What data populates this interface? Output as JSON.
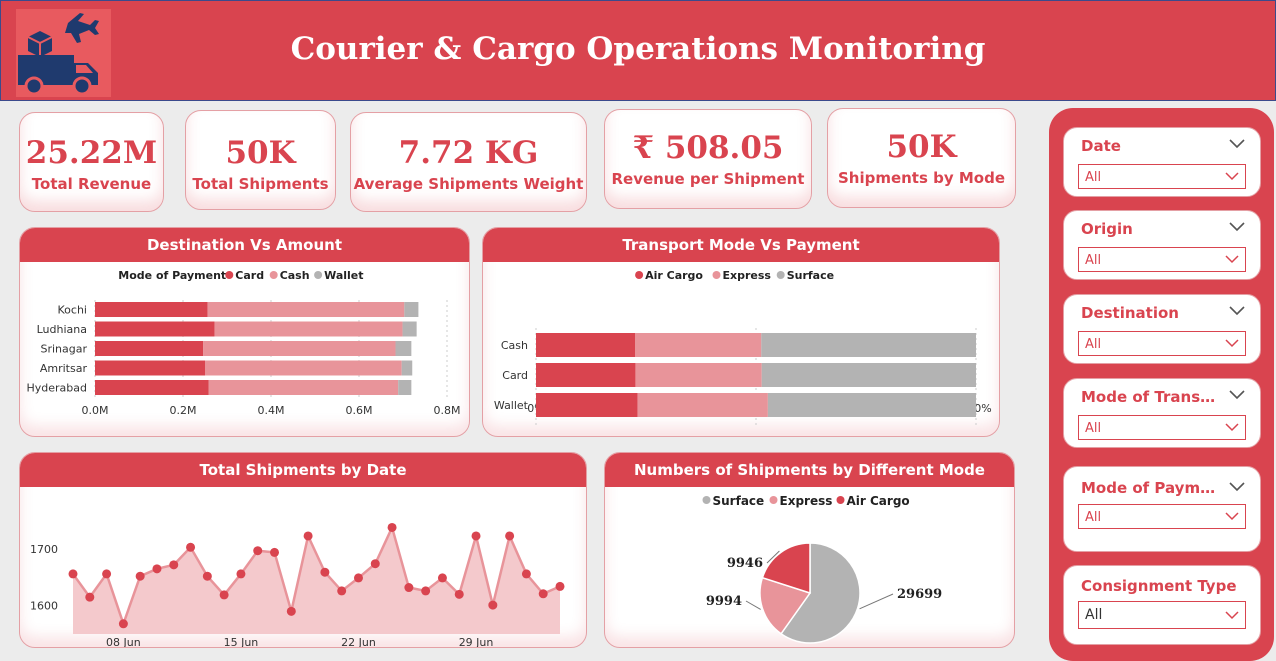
{
  "header": {
    "title": "Courier & Cargo Operations Monitoring",
    "logo_icon": "delivery-truck-plane-icon"
  },
  "kpis": [
    {
      "value": "25.22M",
      "label": "Total Revenue"
    },
    {
      "value": "50K",
      "label": "Total Shipments"
    },
    {
      "value": "7.72 KG",
      "label": "Average Shipments Weight"
    },
    {
      "value": "₹ 508.05",
      "label": "Revenue per Shipment"
    },
    {
      "value": "50K",
      "label": "Shipments by Mode"
    }
  ],
  "colors": {
    "primary": "#d9444f",
    "light": "#e8949a",
    "grey": "#b3b3b3",
    "area": "#f4c9cc"
  },
  "slicers": [
    {
      "name": "Date",
      "value": "All"
    },
    {
      "name": "Origin",
      "value": "All"
    },
    {
      "name": "Destination",
      "value": "All"
    },
    {
      "name": "Mode of Transpo…",
      "value": "All"
    },
    {
      "name": "Mode of Payment",
      "value": "All"
    },
    {
      "name": "Consignment Type",
      "value": "All"
    }
  ],
  "chart_data": [
    {
      "title": "Destination Vs Amount",
      "type": "bar",
      "stacked": true,
      "orientation": "horizontal",
      "legend_title": "Mode of Payment",
      "categories": [
        "Kochi",
        "Ludhiana",
        "Srinagar",
        "Amritsar",
        "Hyderabad"
      ],
      "series": [
        {
          "name": "Card",
          "values": [
            0.256,
            0.272,
            0.246,
            0.25,
            0.258
          ]
        },
        {
          "name": "Cash",
          "values": [
            0.447,
            0.427,
            0.437,
            0.447,
            0.431
          ]
        },
        {
          "name": "Wallet",
          "values": [
            0.032,
            0.032,
            0.036,
            0.024,
            0.03
          ]
        }
      ],
      "x_ticks": [
        "0.0M",
        "0.2M",
        "0.4M",
        "0.6M",
        "0.8M"
      ],
      "xlim": [
        0,
        0.8
      ],
      "legend_position": "top-center"
    },
    {
      "title": "Transport Mode Vs Payment",
      "type": "bar",
      "stacked": true,
      "percent": true,
      "orientation": "horizontal",
      "categories": [
        "Cash",
        "Card",
        "Wallet"
      ],
      "series": [
        {
          "name": "Air Cargo",
          "values": [
            22.5,
            22.6,
            23.1
          ]
        },
        {
          "name": "Express",
          "values": [
            28.7,
            28.7,
            29.6
          ]
        },
        {
          "name": "Surface",
          "values": [
            48.8,
            48.7,
            47.3
          ]
        }
      ],
      "x_ticks": [
        "0%",
        "50%",
        "100%"
      ],
      "legend_position": "top-center"
    },
    {
      "title": "Total Shipments by Date",
      "type": "area",
      "x": [
        "05 Jun",
        "06 Jun",
        "07 Jun",
        "08 Jun",
        "09 Jun",
        "10 Jun",
        "11 Jun",
        "12 Jun",
        "13 Jun",
        "14 Jun",
        "15 Jun",
        "16 Jun",
        "17 Jun",
        "18 Jun",
        "19 Jun",
        "20 Jun",
        "21 Jun",
        "22 Jun",
        "23 Jun",
        "24 Jun",
        "25 Jun",
        "26 Jun",
        "27 Jun",
        "28 Jun",
        "29 Jun",
        "30 Jun",
        "01 Jul",
        "02 Jul",
        "03 Jul",
        "04 Jul"
      ],
      "values": [
        1656,
        1615,
        1656,
        1568,
        1652,
        1665,
        1672,
        1703,
        1652,
        1619,
        1656,
        1697,
        1694,
        1590,
        1723,
        1659,
        1626,
        1649,
        1674,
        1738,
        1632,
        1626,
        1649,
        1620,
        1723,
        1601,
        1723,
        1656,
        1621,
        1634
      ],
      "x_ticks": [
        "08 Jun",
        "15 Jun",
        "22 Jun",
        "29 Jun"
      ],
      "y_ticks": [
        1600,
        1700
      ],
      "ylim": [
        1550,
        1760
      ]
    },
    {
      "title": "Numbers of Shipments by Different Mode",
      "type": "pie",
      "donut": false,
      "categories": [
        "Surface",
        "Express",
        "Air Cargo"
      ],
      "values": [
        29699,
        9994,
        9946
      ],
      "legend_position": "top-center"
    }
  ]
}
